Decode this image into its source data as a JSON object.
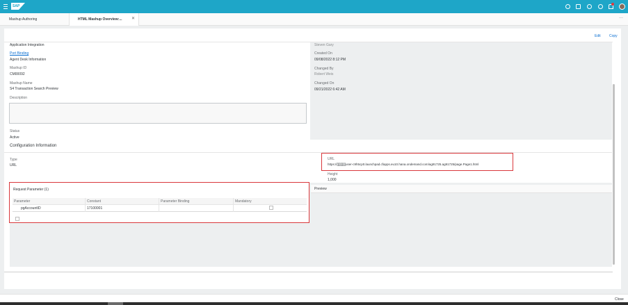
{
  "shell": {
    "logo_text": "SAP",
    "icons": [
      "menu-icon",
      "search-icon",
      "feedback-icon",
      "history-icon",
      "help-icon",
      "notification-icon",
      "user-avatar"
    ],
    "brand_color": "#1ea6c8"
  },
  "tabs": [
    {
      "label": "Mashup Authoring"
    },
    {
      "label": "HTML Mashup Overview:...",
      "active": true,
      "close_label": "✕"
    }
  ],
  "tabbar_overflow": "···",
  "header_actions": {
    "edit": "Edit",
    "copy": "Copy"
  },
  "general": {
    "category_value": "Application Integration",
    "port_binding_label": "Port Binding",
    "port_binding_value": "Agent Desk Information",
    "mashup_id_label": "Mashup ID",
    "mashup_id_value": "CM00092",
    "mashup_name_label": "Mashup Name",
    "mashup_name_value": "S4 Transaction Search Preview",
    "description_label": "Description",
    "status_label": "Status",
    "status_value": "Active",
    "created_by_value": "Steven Gary",
    "created_on_label": "Created On",
    "created_on_value": "09/08/2022 8:12 PM",
    "changed_by_label": "Changed By",
    "changed_by_value": "Robert Weis",
    "changed_on_label": "Changed On",
    "changed_on_value": "09/21/2022 6:42 AM"
  },
  "config": {
    "title": "Configuration Information",
    "type_label": "Type",
    "type_value": "URL",
    "url_label": "URL",
    "url_value": "https://[][][][][]user-c9h5cp0.launchpad.cfapps.eu10.hana.ondemand.com/ag91725.ag91725/page.Page1.html",
    "height_label": "Height",
    "height_value": "1,000"
  },
  "request_parameter": {
    "title": "Request Parameter",
    "count": "(1)",
    "columns": [
      "Parameter",
      "Constant",
      "Parameter Binding",
      "Mandatory"
    ],
    "rows": [
      {
        "parameter": "pgAccountID",
        "constant": "17100001",
        "binding": "",
        "mandatory": false
      }
    ]
  },
  "preview": {
    "label": "Preview"
  },
  "footer": {
    "close": "Close"
  },
  "highlight_color": "#d9373b"
}
